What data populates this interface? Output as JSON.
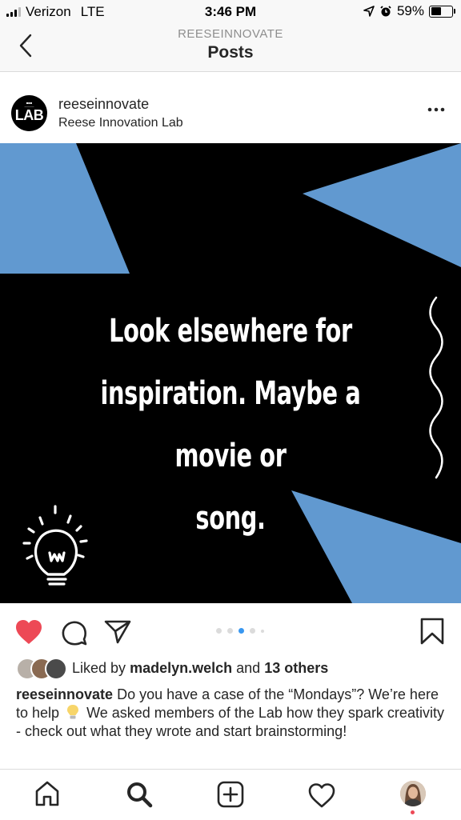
{
  "status_bar": {
    "carrier": "Verizon",
    "network": "LTE",
    "time": "3:46 PM",
    "battery": "59%",
    "battery_level": 0.59
  },
  "header": {
    "account": "REESEINNOVATE",
    "title": "Posts",
    "back_icon": "chevron-left-icon"
  },
  "post": {
    "username": "reeseinnovate",
    "display_name": "Reese Innovation Lab",
    "avatar_text": "LAB",
    "image_lines": [
      "Look elsewhere for",
      "inspiration. Maybe a movie or",
      "song."
    ],
    "image_colors": {
      "background": "#000000",
      "accent": "#6199d0"
    },
    "carousel": {
      "count": 5,
      "active": 3
    },
    "liked": true,
    "liked_prefix": "Liked by",
    "liked_by": "madelyn.welch",
    "liked_and": "and",
    "liked_others": "13 others",
    "caption_user": "reeseinnovate",
    "caption_before": "Do you have a case of the “Mondays”? We’re here to help",
    "caption_after": "We asked members of the Lab how they spark creativity - check out what they wrote and start brainstorming!",
    "caption_emoji": "lightbulb-icon"
  },
  "colors": {
    "like": "#ed4956",
    "text": "#262626",
    "muted": "#8e8e8e",
    "dot_active": "#3897f0"
  },
  "tabbar": [
    "home-icon",
    "search-icon",
    "add-post-icon",
    "activity-heart-icon",
    "profile-avatar"
  ]
}
